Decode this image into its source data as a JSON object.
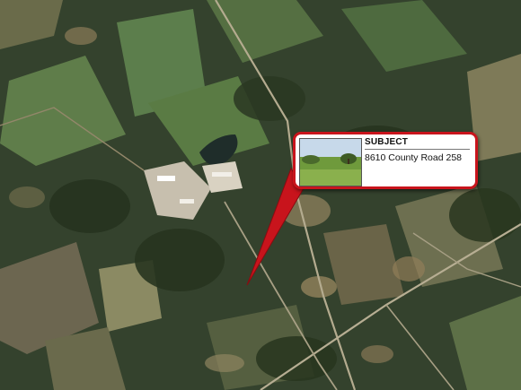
{
  "map": {
    "view": "satellite",
    "icon": "aerial-satellite-map"
  },
  "callout": {
    "title": "SUBJECT",
    "address": "8610 County Road 258",
    "thumbnail_icon": "property-photo",
    "pointer_icon": "red-callout-pointer",
    "border_color": "#c8141c"
  }
}
